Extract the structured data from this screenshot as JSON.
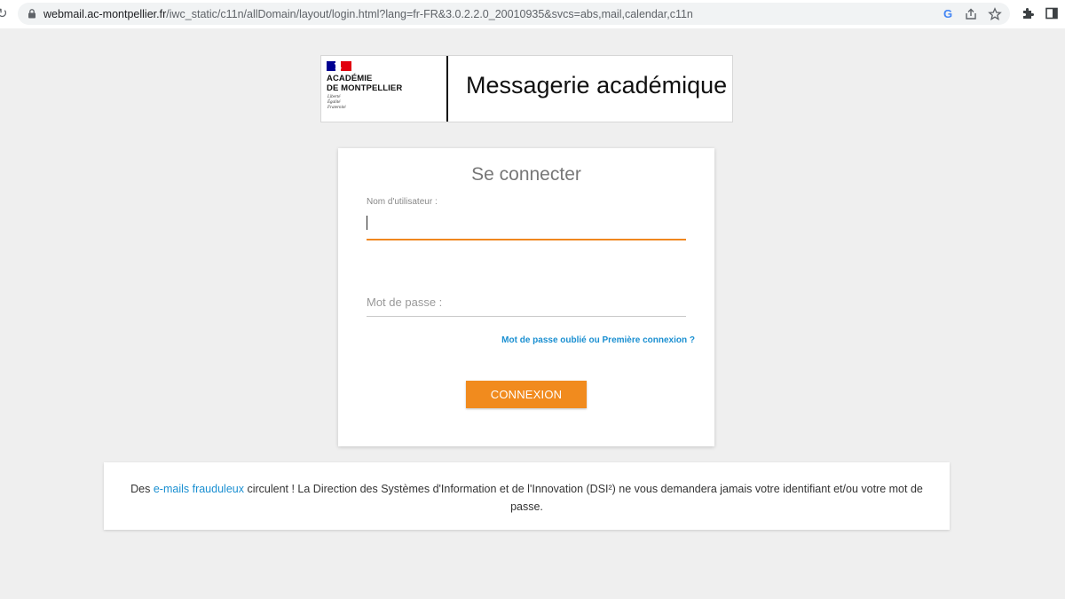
{
  "browser": {
    "url_domain": "webmail.ac-montpellier.fr",
    "url_path": "/iwc_static/c11n/allDomain/layout/login.html?lang=fr-FR&3.0.2.2.0_20010935&svcs=abs,mail,calendar,c11n",
    "icons": [
      "reload-icon",
      "lock-icon",
      "google-icon",
      "share-icon",
      "star-icon",
      "extensions-icon",
      "sidepanel-icon"
    ]
  },
  "header": {
    "logo_line1": "ACADÉMIE",
    "logo_line2": "DE MONTPELLIER",
    "motto": [
      "Liberté",
      "Égalité",
      "Fraternité"
    ],
    "title": "Messagerie académique"
  },
  "login": {
    "title": "Se connecter",
    "username_label": "Nom d'utilisateur :",
    "username_value": "",
    "password_placeholder": "Mot de passe :",
    "forgot_link": "Mot de passe oublié ou Première connexion ?",
    "submit_label": "CONNEXION"
  },
  "warning": {
    "prefix": "Des ",
    "link": "e-mails frauduleux",
    "suffix": " circulent ! La Direction des Systèmes d'Information et de l'Innovation (DSI²) ne vous demandera jamais votre identifiant et/ou votre mot de passe."
  },
  "colors": {
    "accent_orange": "#f18b1e",
    "link_blue": "#1a8fd1",
    "page_bg": "#efefef"
  }
}
